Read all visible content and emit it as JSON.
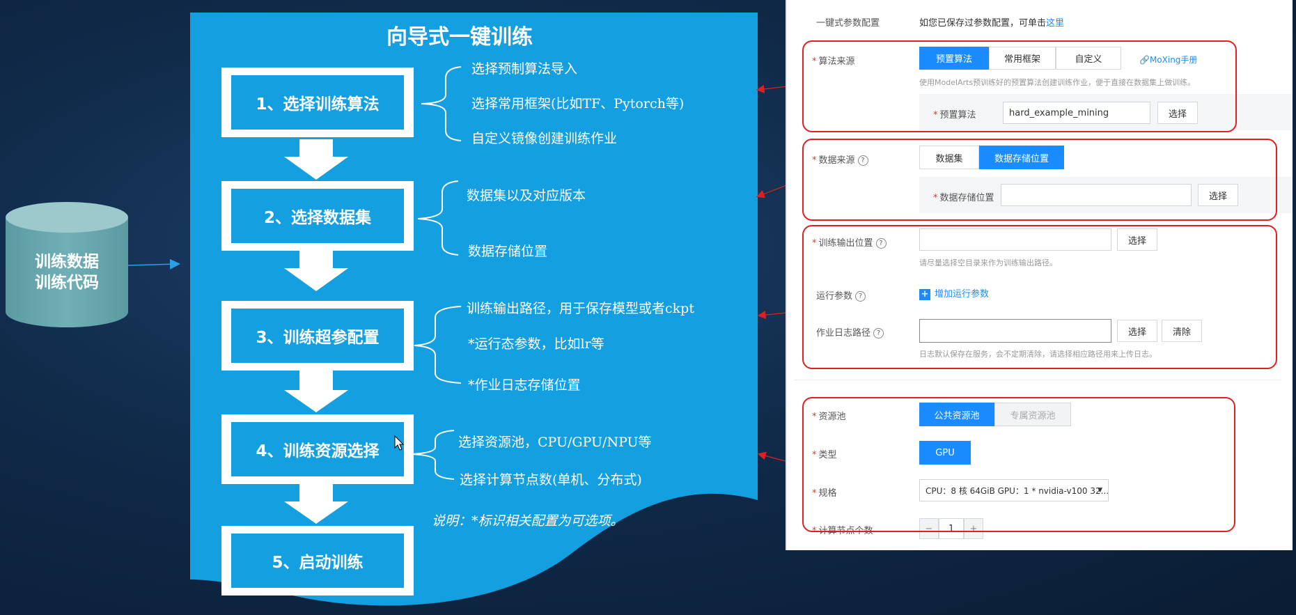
{
  "left_db": {
    "line1": "训练数据",
    "line2": "训练代码"
  },
  "wizard": {
    "title": "向导式一键训练",
    "steps": [
      {
        "label": "1、选择训练算法",
        "items": [
          "选择预制算法导入",
          "选择常用框架(比如TF、Pytorch等)",
          "自定义镜像创建训练作业"
        ]
      },
      {
        "label": "2、选择数据集",
        "items": [
          "数据集以及对应版本",
          "数据存储位置"
        ]
      },
      {
        "label": "3、训练超参配置",
        "items": [
          "训练输出路径，用于保存模型或者ckpt",
          "*运行态参数，比如lr等",
          "*作业日志存储位置"
        ]
      },
      {
        "label": "4、训练资源选择",
        "items": [
          "选择资源池，CPU/GPU/NPU等",
          "选择计算节点数(单机、分布式)"
        ]
      },
      {
        "label": "5、启动训练",
        "items": []
      }
    ],
    "note": "说明：*标识相关配置为可选项。"
  },
  "form": {
    "one_click": {
      "label": "一键式参数配置",
      "text": "如您已保存过参数配置，可单击",
      "link": "这里"
    },
    "algorithm": {
      "label": "算法来源",
      "tabs": [
        "预置算法",
        "常用框架",
        "自定义"
      ],
      "manual_link": "MoXing手册",
      "hint": "使用ModelArts预训练好的预置算法创建训练作业，便于直接在数据集上做训练。",
      "sub_label": "预置算法",
      "value": "hard_example_mining",
      "select": "选择"
    },
    "data": {
      "label": "数据来源",
      "tabs": [
        "数据集",
        "数据存储位置"
      ],
      "sub_label": "数据存储位置",
      "value": "",
      "select": "选择"
    },
    "output": {
      "label": "训练输出位置",
      "value": "",
      "select": "选择",
      "hint": "请尽量选择空目录来作为训练输出路径。"
    },
    "params": {
      "label": "运行参数",
      "add": "增加运行参数"
    },
    "log": {
      "label": "作业日志路径",
      "value": "",
      "select": "选择",
      "clear": "清除",
      "hint": "日志默认保存在服务，会不定期清除，请选择相应路径用来上传日志。"
    },
    "pool": {
      "label": "资源池",
      "tabs": [
        "公共资源池",
        "专属资源池"
      ]
    },
    "type": {
      "label": "类型",
      "value": "GPU"
    },
    "spec": {
      "label": "规格",
      "value": "CPU：8 核 64GiB GPU：1 * nvidia-v100 32..."
    },
    "nodes": {
      "label": "计算节点个数",
      "value": "1",
      "minus": "−",
      "plus": "+"
    }
  },
  "colors": {
    "panel": "#149fe0",
    "background": "#102a49",
    "accent": "#1a8cff",
    "highlight": "#e02020"
  }
}
